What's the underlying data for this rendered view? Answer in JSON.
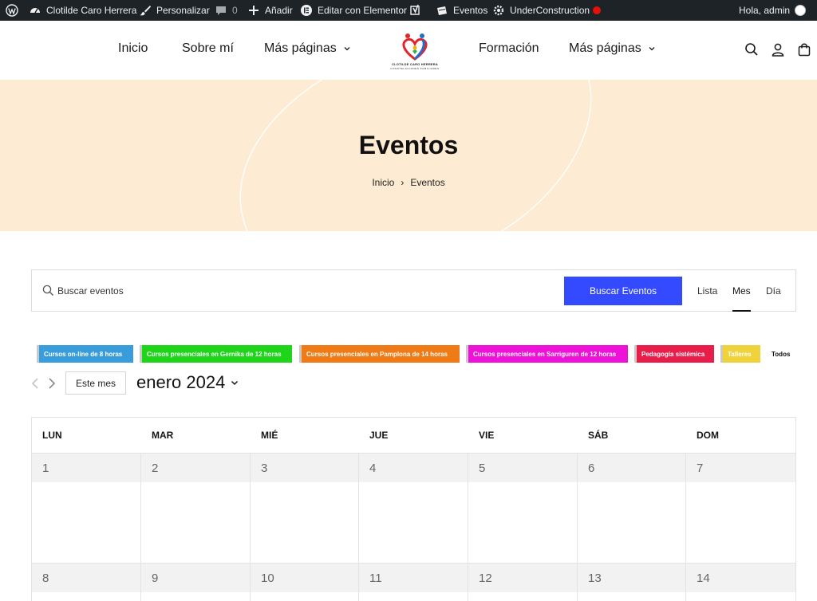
{
  "admin_bar": {
    "site_name": "Clotilde Caro Herrera",
    "customize": "Personalizar",
    "comments_count": "0",
    "add_new": "Añadir",
    "elementor": "Editar con Elementor",
    "events": "Eventos",
    "under_construction": "UnderConstruction",
    "greeting": "Hola, admin"
  },
  "nav": {
    "inicio": "Inicio",
    "sobre": "Sobre mí",
    "mas1": "Más páginas",
    "formacion": "Formación",
    "mas2": "Más páginas"
  },
  "logo": {
    "line1": "CLOTILDE CARO HERRERA",
    "line2": "CONSTELACIONES FAMILIARES"
  },
  "hero": {
    "title": "Eventos",
    "breadcrumb_home": "Inicio",
    "breadcrumb_sep": "›",
    "breadcrumb_current": "Eventos"
  },
  "search": {
    "placeholder": "Buscar eventos",
    "button": "Buscar Eventos",
    "views": {
      "list": "Lista",
      "month": "Mes",
      "day": "Día"
    }
  },
  "categories": [
    {
      "label": "Cursos on-line de 8 horas",
      "color": "#3a9ddb"
    },
    {
      "label": "Cursos presenciales en Gernika de 12 horas",
      "color": "#1ed51a"
    },
    {
      "label": "Cursos presenciales en Pamplona de 14 horas",
      "color": "#f07a15"
    },
    {
      "label": "Cursos presenciales en Sarriguren de 12 horas",
      "color": "#ee11d8"
    },
    {
      "label": "Pedagogía sistémica",
      "color": "#e81d4a"
    },
    {
      "label": "Talleres",
      "color": "#f0d23a"
    }
  ],
  "categories_all": "Todos",
  "month_nav": {
    "today": "Este mes",
    "current": "enero 2024"
  },
  "calendar": {
    "weekdays": [
      "LUN",
      "MAR",
      "MIÉ",
      "JUE",
      "VIE",
      "SÁB",
      "DOM"
    ],
    "week1": [
      "1",
      "2",
      "3",
      "4",
      "5",
      "6",
      "7"
    ],
    "week2": [
      "8",
      "9",
      "10",
      "11",
      "12",
      "13",
      "14"
    ]
  },
  "colors": {
    "admin_bar_bg": "#1d2327",
    "hero_bg": "#fdebd3",
    "accent": "#334aff",
    "day_header_bg": "#f2f2f2"
  }
}
